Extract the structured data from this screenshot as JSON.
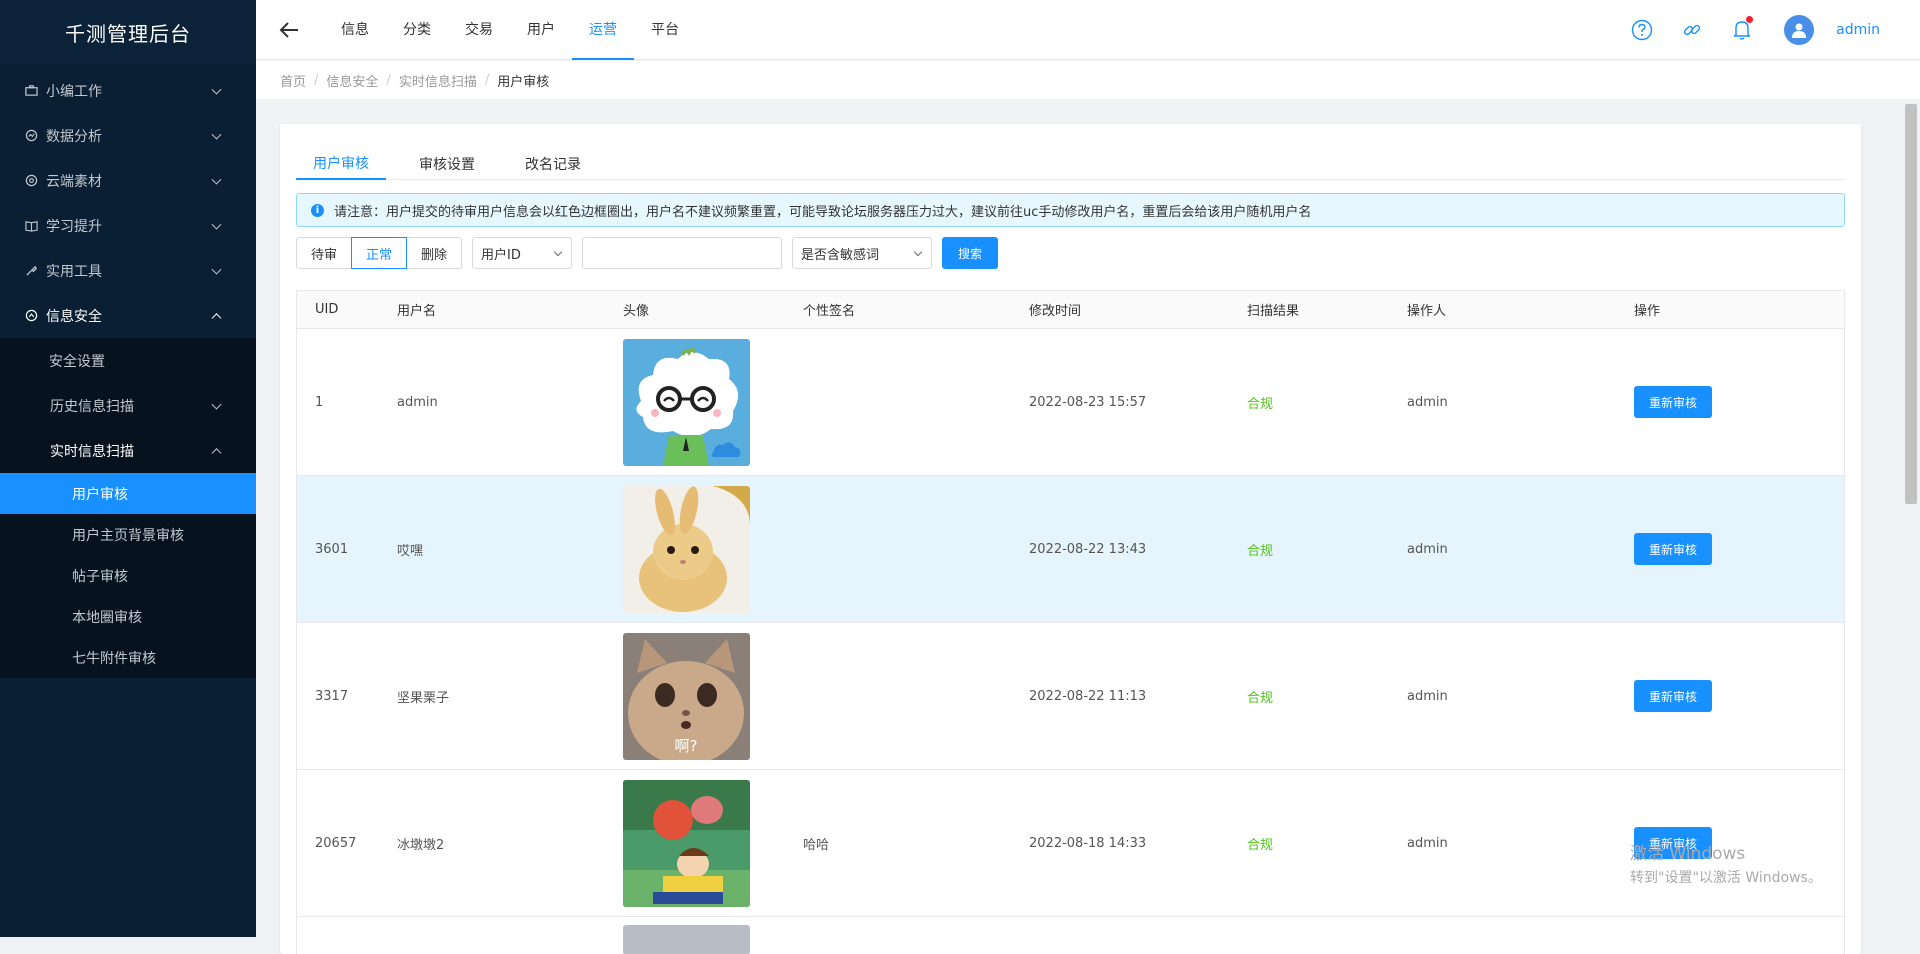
{
  "app_title": "千测管理后台",
  "sidebar": {
    "items": [
      {
        "label": "小编工作",
        "icon": "briefcase-icon"
      },
      {
        "label": "数据分析",
        "icon": "chart-icon"
      },
      {
        "label": "云端素材",
        "icon": "cloud-icon"
      },
      {
        "label": "学习提升",
        "icon": "book-icon"
      },
      {
        "label": "实用工具",
        "icon": "tool-icon"
      },
      {
        "label": "信息安全",
        "icon": "shield-icon"
      }
    ],
    "security_sub": [
      "安全设置",
      "历史信息扫描",
      "实时信息扫描"
    ],
    "realtime_sub": [
      "用户审核",
      "用户主页背景审核",
      "帖子审核",
      "本地圈审核",
      "七牛附件审核"
    ]
  },
  "topnav": {
    "tabs": [
      "信息",
      "分类",
      "交易",
      "用户",
      "运营",
      "平台"
    ],
    "active": "运营",
    "user": "admin"
  },
  "breadcrumb": [
    "首页",
    "信息安全",
    "实时信息扫描",
    "用户审核"
  ],
  "content_tabs": [
    "用户审核",
    "审核设置",
    "改名记录"
  ],
  "alert": "请注意：用户提交的待审用户信息会以红色边框圈出，用户名不建议频繁重置，可能导致论坛服务器压力过大，建议前往uc手动修改用户名，重置后会给该用户随机用户名",
  "filters": {
    "status": [
      "待审",
      "正常",
      "删除"
    ],
    "status_active": "正常",
    "field_select": "用户ID",
    "search_value": "",
    "sensitive_select": "是否含敏感词",
    "search_button": "搜索"
  },
  "table": {
    "columns": [
      "UID",
      "用户名",
      "头像",
      "个性签名",
      "修改时间",
      "扫描结果",
      "操作人",
      "操作"
    ],
    "rows": [
      {
        "uid": "1",
        "name": "admin",
        "avatar": "cloud-mascot",
        "signature": "",
        "time": "2022-08-23 15:57",
        "result": "合规",
        "operator": "admin",
        "action": "重新审核"
      },
      {
        "uid": "3601",
        "name": "哎嘿",
        "avatar": "bunny",
        "signature": "",
        "time": "2022-08-22 13:43",
        "result": "合规",
        "operator": "admin",
        "action": "重新审核"
      },
      {
        "uid": "3317",
        "name": "坚果栗子",
        "avatar": "cat",
        "avatar_caption": "啊?",
        "signature": "",
        "time": "2022-08-22 11:13",
        "result": "合规",
        "operator": "admin",
        "action": "重新审核"
      },
      {
        "uid": "20657",
        "name": "冰墩墩2",
        "avatar": "anime",
        "signature": "哈哈",
        "time": "2022-08-18 14:33",
        "result": "合规",
        "operator": "admin",
        "action": "重新审核"
      }
    ]
  },
  "watermark": {
    "line1": "激活 Windows",
    "line2": "转到\"设置\"以激活 Windows。"
  }
}
